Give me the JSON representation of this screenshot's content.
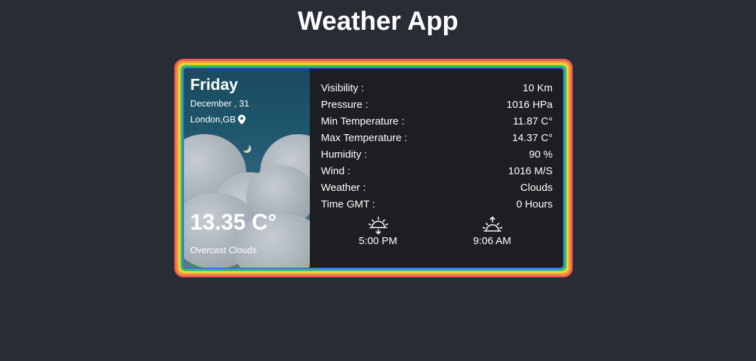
{
  "app": {
    "title": "Weather App"
  },
  "summary": {
    "day": "Friday",
    "date": "December , 31",
    "location": "London,GB",
    "temperature": "13.35 C°",
    "description": "Overcast Clouds"
  },
  "details": [
    {
      "label": "Visibility :",
      "value": "10 Km"
    },
    {
      "label": "Pressure :",
      "value": "1016 HPa"
    },
    {
      "label": "Min Temperature :",
      "value": "11.87 C°"
    },
    {
      "label": "Max Temperature :",
      "value": "14.37 C°"
    },
    {
      "label": "Humidity :",
      "value": "90 %"
    },
    {
      "label": "Wind :",
      "value": "1016 M/S"
    },
    {
      "label": "Weather :",
      "value": "Clouds"
    },
    {
      "label": "Time GMT :",
      "value": "0 Hours"
    }
  ],
  "sun": {
    "sunset": {
      "icon": "sunset-icon",
      "time": "5:00 PM"
    },
    "sunrise": {
      "icon": "sunrise-icon",
      "time": "9:06 AM"
    }
  },
  "colors": {
    "background": "#282c34",
    "card": "#1d1e22",
    "border_rainbow": [
      "#ef5b5b",
      "#f29a38",
      "#f2d43a",
      "#35c25b",
      "#3a6cf0"
    ]
  },
  "icons": {
    "location": "map-pin-icon"
  }
}
